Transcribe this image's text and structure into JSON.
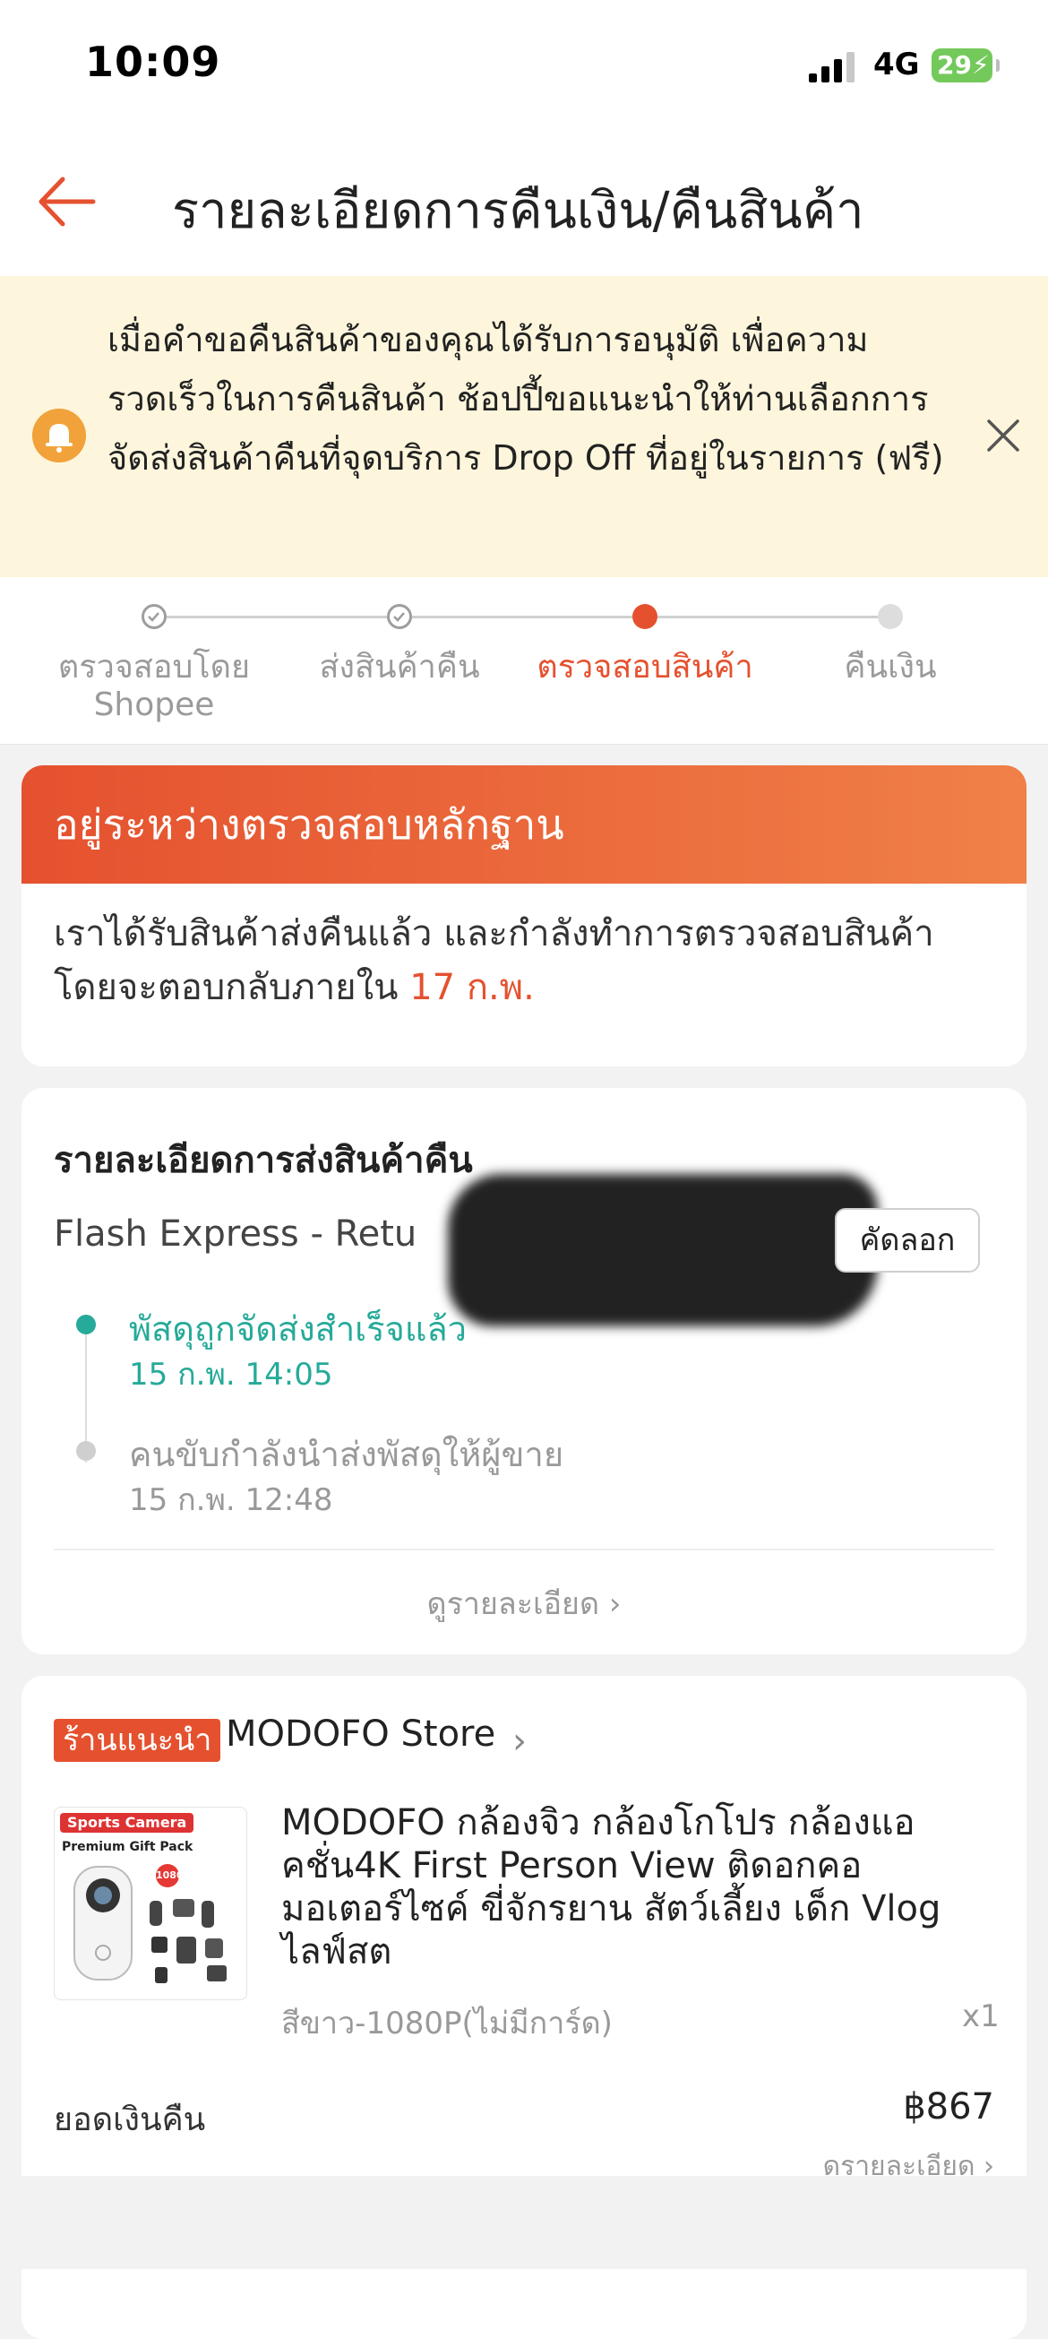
{
  "status_bar": {
    "time": "10:09",
    "network": "4G",
    "battery": "29"
  },
  "header": {
    "title": "รายละเอียดการคืนเงิน/คืนสินค้า"
  },
  "notice": {
    "text": "เมื่อคำขอคืนสินค้าของคุณได้รับการอนุมัติ เพื่อความรวดเร็วในการคืนสินค้า ช้อปปี้ขอแนะนำให้ท่านเลือกการจัดส่งสินค้าคืนที่จุดบริการ Drop Off ที่อยู่ในรายการ (ฟรี)",
    "icon": "bell-icon",
    "accent": "#f2a23a"
  },
  "stepper": {
    "steps": [
      {
        "label": "ตรวจสอบโดย Shopee",
        "state": "done"
      },
      {
        "label": "ส่งสินค้าคืน",
        "state": "done"
      },
      {
        "label": "ตรวจสอบสินค้า",
        "state": "current"
      },
      {
        "label": "คืนเงิน",
        "state": "pending"
      }
    ]
  },
  "status_card": {
    "banner": "อยู่ระหว่างตรวจสอบหลักฐาน",
    "body_prefix": "เราได้รับสินค้าส่งคืนแล้ว และกำลังทำการตรวจสอบสินค้าโดยจะตอบกลับภายใน",
    "body_date": "17 ก.พ."
  },
  "shipping": {
    "title": "รายละเอียดการส่งสินค้าคืน",
    "courier": "Flash Express - Retu",
    "copy_label": "คัดลอก",
    "events": [
      {
        "text": "พัสดุถูกจัดส่งสำเร็จแล้ว",
        "time": "15 ก.พ. 14:05"
      },
      {
        "text": "คนขับกำลังนำส่งพัสดุให้ผู้ขาย",
        "time": "15 ก.พ. 12:48"
      }
    ],
    "view_more": "ดูรายละเอียด"
  },
  "product": {
    "store_badge": "ร้านแนะนำ",
    "store_name": "MODOFO Store",
    "thumb_banner": "Sports Camera",
    "thumb_sub": "Premium Gift Pack",
    "thumb_res": "1080",
    "name": "MODOFO กล้องจิว กล้องโกโปร กล้องแอคชั่น4K First Person View ติดอกคอ มอเตอร์ไซค์ ขี่จักรยาน สัตว์เลี้ยง เด็ก Vlog ไลฟ์สต",
    "variant": "สีขาว-1080P(ไม่มีการ์ด)",
    "qty": "x1",
    "refund_label": "ยอดเงินคืน",
    "refund_amount": "฿867",
    "refund_more": "ดูรายละเอียด"
  },
  "colors": {
    "brand": "#e5512f",
    "success": "#26aa99"
  }
}
